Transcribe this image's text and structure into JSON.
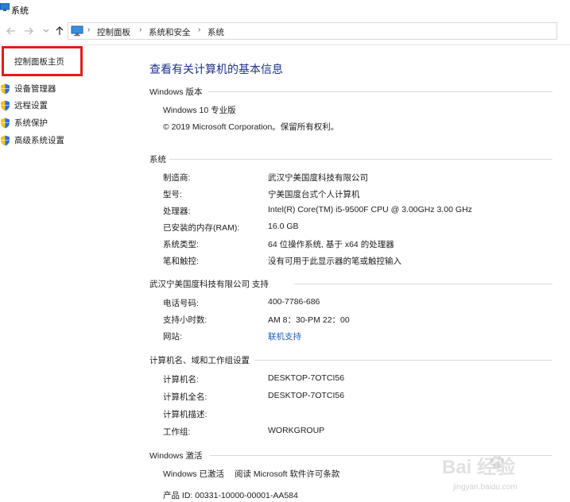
{
  "window": {
    "title": "系统",
    "icon": "system-window-icon"
  },
  "nav": {
    "back_icon": "back-arrow-icon",
    "forward_icon": "forward-arrow-icon",
    "up_icon": "up-arrow-icon",
    "location_icon": "computer-icon",
    "breadcrumb": [
      "控制面板",
      "系统和安全",
      "系统"
    ]
  },
  "sidebar": {
    "home_label": "控制面板主页",
    "highlight_color": "#e21c1c",
    "items": [
      {
        "label": "设备管理器",
        "icon": "shield-icon"
      },
      {
        "label": "远程设置",
        "icon": "shield-icon"
      },
      {
        "label": "系统保护",
        "icon": "shield-icon"
      },
      {
        "label": "高级系统设置",
        "icon": "shield-icon"
      }
    ]
  },
  "main": {
    "title": "查看有关计算机的基本信息",
    "edition": {
      "header": "Windows 版本",
      "name": "Windows 10 专业版",
      "copyright": "© 2019 Microsoft Corporation。保留所有权利。"
    },
    "system": {
      "header": "系统",
      "rows": [
        {
          "label": "制造商:",
          "value": "武汉宁美国度科技有限公司"
        },
        {
          "label": "型号:",
          "value": "宁美国度台式个人计算机"
        },
        {
          "label": "处理器:",
          "value": "Intel(R) Core(TM) i5-9500F CPU @ 3.00GHz   3.00 GHz"
        },
        {
          "label": "已安装的内存(RAM):",
          "value": "16.0 GB"
        },
        {
          "label": "系统类型:",
          "value": "64 位操作系统, 基于 x64 的处理器"
        },
        {
          "label": "笔和触控:",
          "value": "没有可用于此显示器的笔或触控输入"
        }
      ]
    },
    "support": {
      "header": "武汉宁美国度科技有限公司 支持",
      "rows": [
        {
          "label": "电话号码:",
          "value": "400-7786-686"
        },
        {
          "label": "支持小时数:",
          "value": "AM 8：30-PM 22：00"
        },
        {
          "label": "网站:",
          "value": "联机支持"
        }
      ]
    },
    "computer_name": {
      "header": "计算机名、域和工作组设置",
      "rows": [
        {
          "label": "计算机名:",
          "value": "DESKTOP-7OTCI56"
        },
        {
          "label": "计算机全名:",
          "value": "DESKTOP-7OTCI56"
        },
        {
          "label": "计算机描述:",
          "value": ""
        },
        {
          "label": "工作组:",
          "value": "WORKGROUP"
        }
      ]
    },
    "activation": {
      "header": "Windows 激活",
      "status": "Windows 已激活",
      "license_link": "阅读 Microsoft 软件许可条款",
      "product_id": "产品 ID: 00331-10000-00001-AA584"
    }
  },
  "watermark": {
    "logo": "Bai  经验",
    "url": "jingyan.baidu.com"
  },
  "colors": {
    "title_blue": "#1e3287",
    "link_blue": "#1c5fc2"
  }
}
